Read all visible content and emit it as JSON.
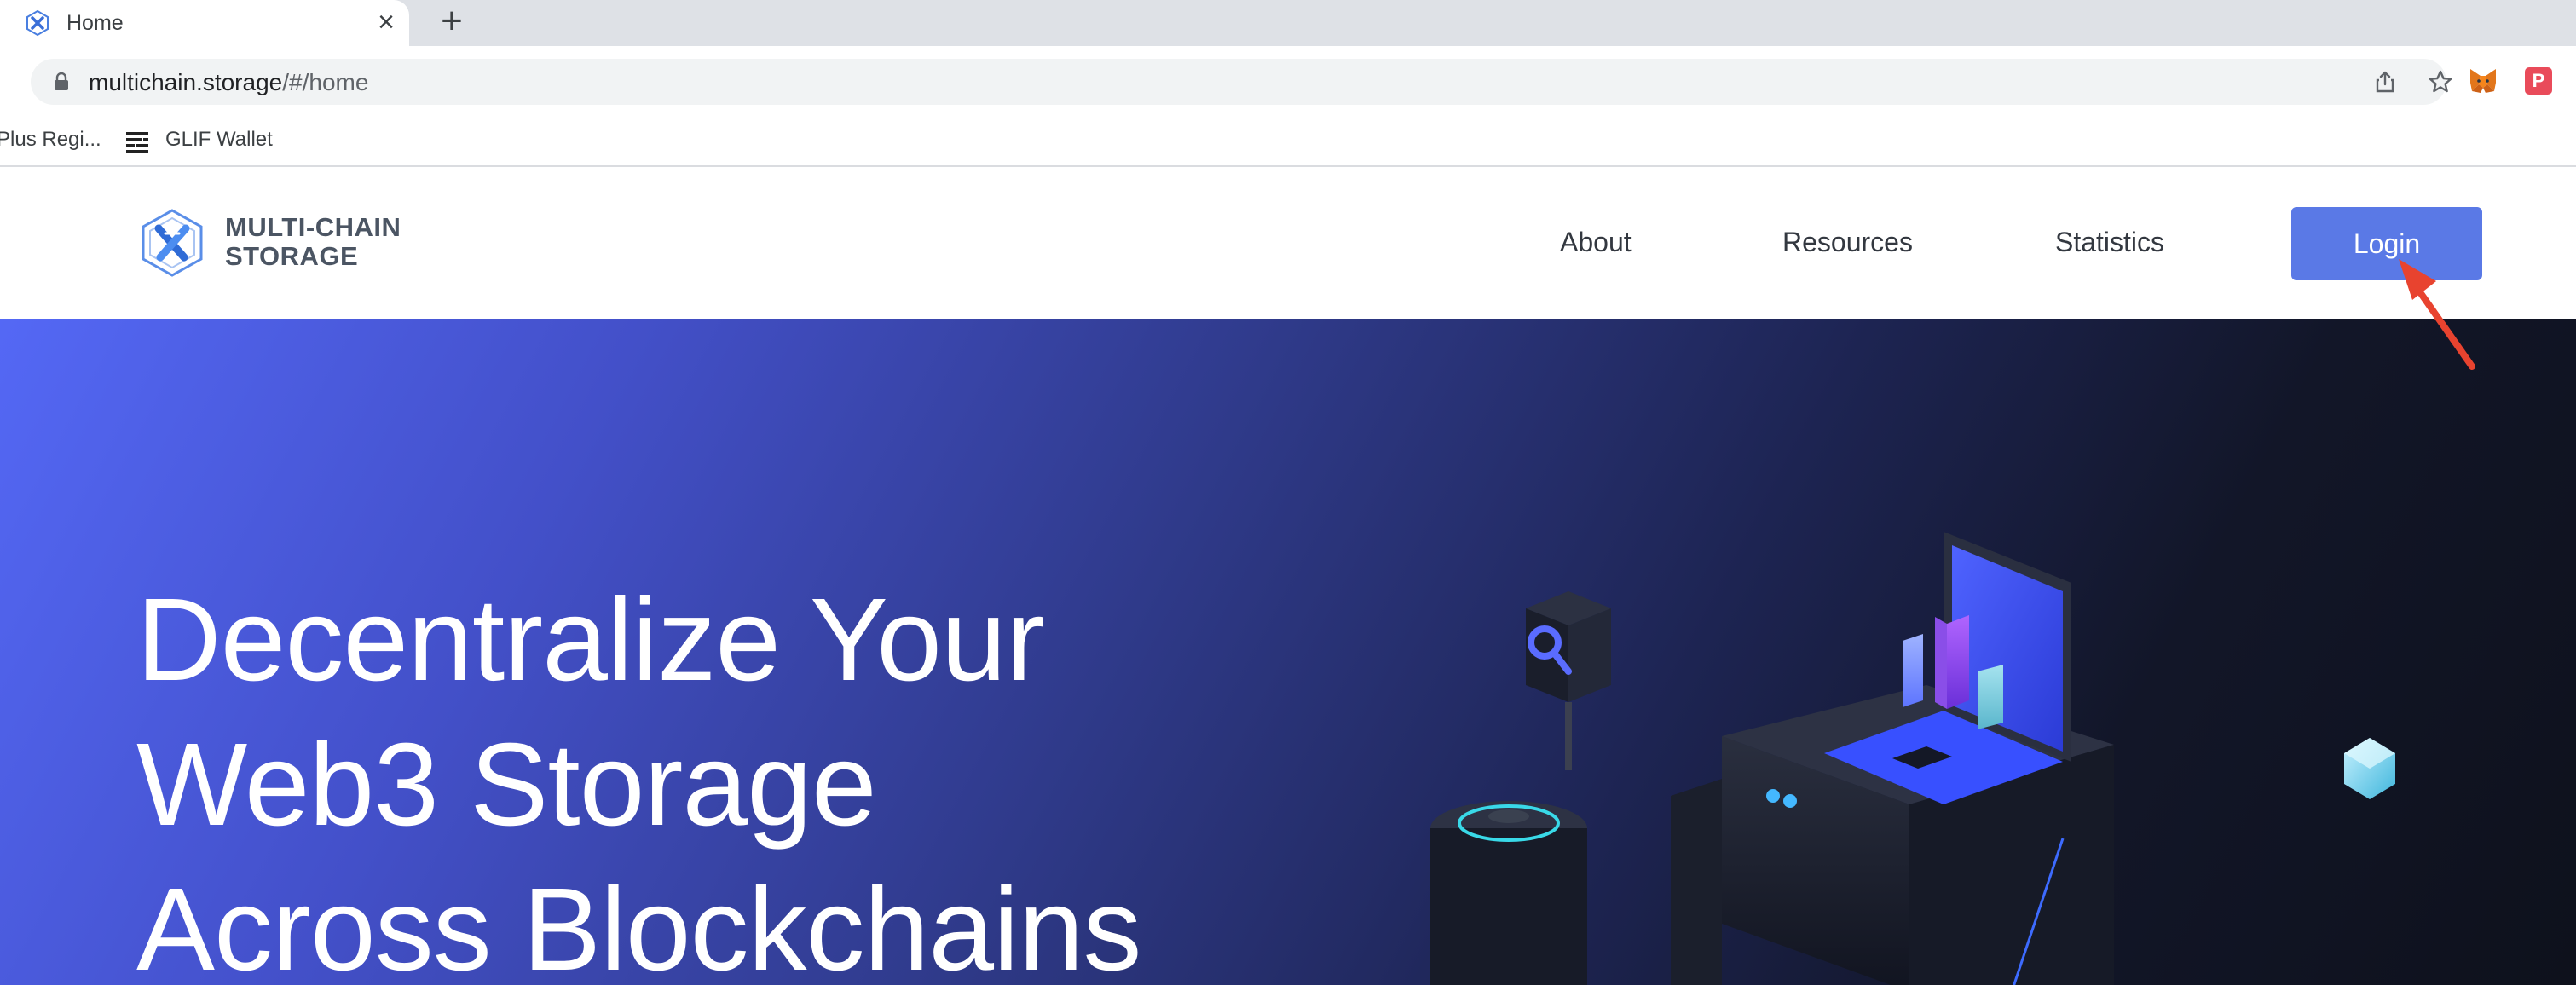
{
  "browser": {
    "tab": {
      "title": "Home",
      "favicon": "multichain-logo-icon"
    },
    "new_tab_symbol": "+",
    "close_symbol": "×",
    "address": {
      "host": "multichain.storage",
      "path": "/#/home"
    },
    "bookmarks": [
      {
        "label": "Plus Regi..."
      },
      {
        "label": "GLIF Wallet",
        "icon": "glif-icon"
      }
    ],
    "extensions": [
      {
        "name": "metamask-fox-icon"
      },
      {
        "name": "extension-p-icon",
        "letter": "P"
      }
    ]
  },
  "site": {
    "logo": {
      "line1": "MULTI-CHAIN",
      "line2": "STORAGE"
    },
    "nav": {
      "about": "About",
      "resources": "Resources",
      "statistics": "Statistics",
      "login": "Login"
    }
  },
  "hero": {
    "title_lines": [
      "Decentralize Your",
      "Web3 Storage",
      "Across Blockchains"
    ]
  },
  "colors": {
    "accent": "#5a79e6",
    "annotation_arrow": "#e8432f",
    "hero_start": "#5468f5",
    "hero_end": "#0e111c"
  }
}
